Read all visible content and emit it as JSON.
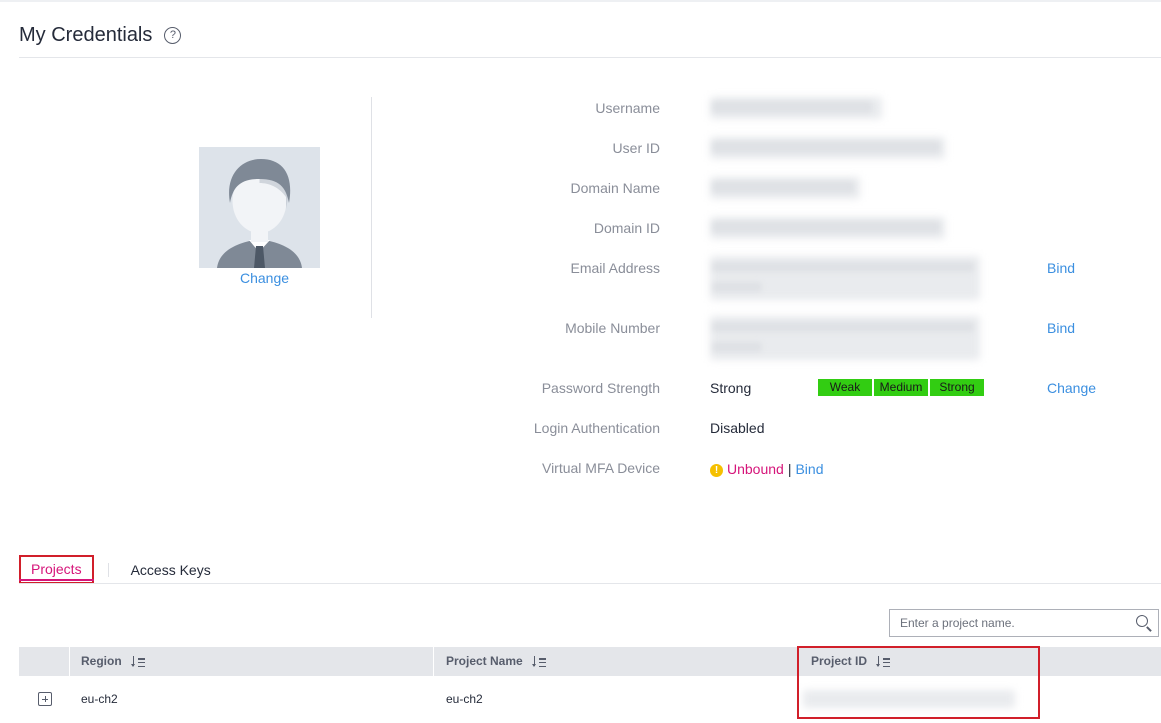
{
  "header": {
    "title": "My Credentials"
  },
  "avatar": {
    "change_label": "Change"
  },
  "info": {
    "username_label": "Username",
    "user_id_label": "User ID",
    "domain_name_label": "Domain Name",
    "domain_id_label": "Domain ID",
    "email_label": "Email Address",
    "email_action": "Bind",
    "mobile_label": "Mobile Number",
    "mobile_action": "Bind",
    "password_strength_label": "Password Strength",
    "password_strength_value": "Strong",
    "strength_levels": [
      "Weak",
      "Medium",
      "Strong"
    ],
    "password_action": "Change",
    "login_auth_label": "Login Authentication",
    "login_auth_value": "Disabled",
    "mfa_label": "Virtual MFA Device",
    "mfa_status": "Unbound",
    "mfa_separator": "|",
    "mfa_action": "Bind"
  },
  "tabs": {
    "projects": "Projects",
    "access_keys": "Access Keys"
  },
  "search": {
    "placeholder": "Enter a project name."
  },
  "table": {
    "columns": [
      "Region",
      "Project Name",
      "Project ID"
    ],
    "rows": [
      {
        "region": "eu-ch2",
        "project_name": "eu-ch2"
      }
    ]
  },
  "colors": {
    "link": "#3b8fe0",
    "strength_green": "#32cd12",
    "unbound": "#d6157a",
    "highlight_red": "#d11f2a"
  }
}
